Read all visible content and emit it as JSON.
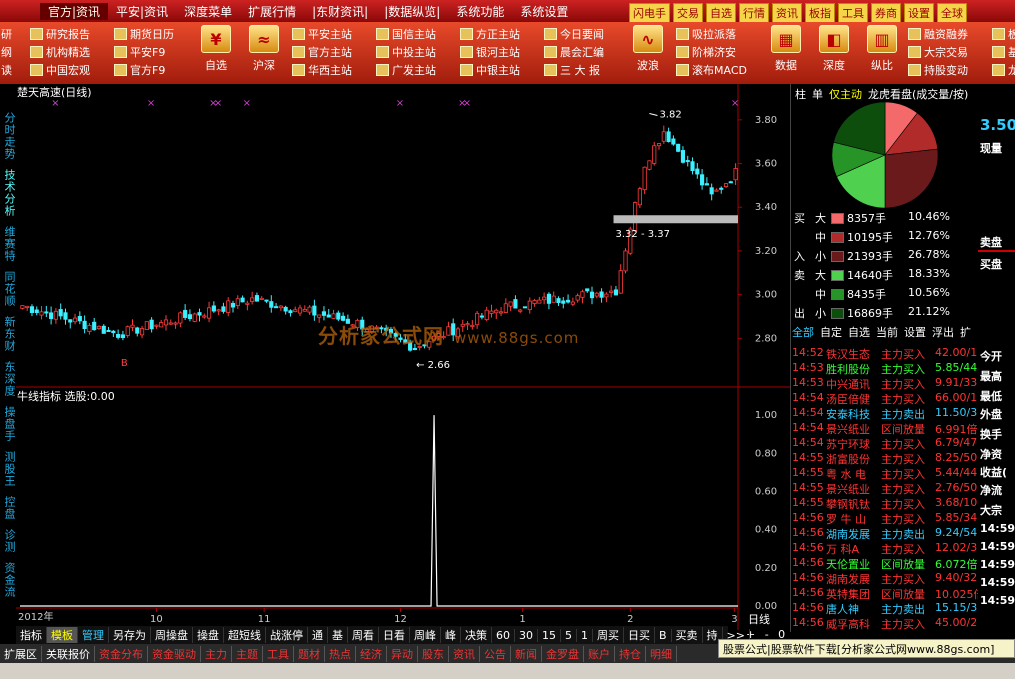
{
  "menu": {
    "items": [
      "官方|资讯",
      "平安|资讯",
      "深度菜单",
      "扩展行情",
      "|东财资讯|",
      "|数据纵览|",
      "系统功能",
      "系统设置"
    ],
    "quick": [
      "闪电手",
      "交易",
      "自选",
      "行情",
      "资讯",
      "板指",
      "工具",
      "券商",
      "设置",
      "全球"
    ]
  },
  "toolbar": {
    "col0": [
      "研",
      "纲",
      "读"
    ],
    "col1": [
      "研究报告",
      "机构精选",
      "中国宏观"
    ],
    "col2": [
      "期货日历",
      "平安F9",
      "官方F9"
    ],
    "big_ziXuan": "自选",
    "big_huShen": "沪深",
    "col3": [
      "平安主站",
      "官方主站",
      "华西主站"
    ],
    "col4": [
      "国信主站",
      "中投主站",
      "广发主站"
    ],
    "col5": [
      "方正主站",
      "银河主站",
      "中银主站"
    ],
    "col6": [
      "今日要闻",
      "晨会汇编",
      "三 大 报"
    ],
    "big_boLang": "波浪",
    "col7": [
      "吸拉派落",
      "阶梯济安",
      "滚布MACD"
    ],
    "big_shuJu": "数据",
    "big_shenDu": "深度",
    "big_zongBi": "纵比",
    "col8": [
      "融资融券",
      "大宗交易",
      "持股变动"
    ],
    "col9": [
      "板",
      "基",
      "龙"
    ]
  },
  "left_tabs": [
    "分时走势",
    "技术分析",
    "维赛特",
    "同花顺",
    "新东财",
    "东深度",
    "操盘手",
    "测股王",
    "控盘",
    "诊测",
    "资金流"
  ],
  "chart": {
    "title": "楚天高速(日线)",
    "indicator_title": "牛线指标 选股:0.00",
    "watermark": "分析家公式网",
    "watermark_url": "www.88gs.com",
    "high_label": "3.82",
    "low_label": "2.66",
    "zone_label": "3.32 - 3.37",
    "b_label": "B",
    "year_label": "2012年",
    "x_ticks": [
      "10",
      "11",
      "12",
      "1",
      "2",
      "3"
    ],
    "y_ticks_price": [
      "3.80",
      "3.60",
      "3.40",
      "3.20",
      "3.00",
      "2.80"
    ],
    "y_ticks_indic": [
      "1.00",
      "0.80",
      "0.60",
      "0.40",
      "0.20",
      "0.00"
    ]
  },
  "chart_data": {
    "type": "candlestick",
    "title": "楚天高速(日线)",
    "ylim": [
      2.6,
      3.9
    ],
    "y_ticks": [
      2.8,
      3.0,
      3.2,
      3.4,
      3.6,
      3.8
    ],
    "x_ticks": [
      "10",
      "11",
      "12",
      "1",
      "2",
      "3"
    ],
    "annotations": [
      {
        "text": "3.82",
        "value": 3.82
      },
      {
        "text": "2.66",
        "value": 2.66
      },
      {
        "text": "3.32 - 3.37",
        "value": 3.345
      }
    ],
    "segments": [
      {
        "from": 0,
        "to": 20,
        "start": 2.95,
        "end": 2.82
      },
      {
        "from": 20,
        "to": 38,
        "start": 2.82,
        "end": 2.92
      },
      {
        "from": 38,
        "to": 48,
        "start": 2.92,
        "end": 2.98
      },
      {
        "from": 48,
        "to": 70,
        "start": 2.98,
        "end": 2.87
      },
      {
        "from": 70,
        "to": 82,
        "start": 2.87,
        "end": 2.76
      },
      {
        "from": 82,
        "to": 100,
        "start": 2.76,
        "end": 2.94
      },
      {
        "from": 100,
        "to": 118,
        "start": 2.94,
        "end": 3.0
      },
      {
        "from": 118,
        "to": 124,
        "start": 3.0,
        "end": 3.02
      },
      {
        "from": 124,
        "to": 130,
        "start": 3.02,
        "end": 3.6
      },
      {
        "from": 130,
        "to": 134,
        "start": 3.6,
        "end": 3.75
      },
      {
        "from": 134,
        "to": 144,
        "start": 3.75,
        "end": 3.45
      },
      {
        "from": 144,
        "to": 150,
        "start": 3.45,
        "end": 3.58
      }
    ],
    "indicator": {
      "ylim": [
        0,
        1.1
      ],
      "spike_index": 86,
      "spike_value": 1.0
    }
  },
  "right": {
    "tabs": [
      "柱",
      "单",
      "仅主动",
      "龙虎看盘(成交量/按)"
    ],
    "flows": [
      {
        "a": "买",
        "b": "大",
        "v": "8357手",
        "p": "10.46%",
        "color": "#f46a6a"
      },
      {
        "a": "",
        "b": "中",
        "v": "10195手",
        "p": "12.76%",
        "color": "#b22b2b"
      },
      {
        "a": "入",
        "b": "小",
        "v": "21393手",
        "p": "26.78%",
        "color": "#6a1a1a"
      },
      {
        "a": "卖",
        "b": "大",
        "v": "14640手",
        "p": "18.33%",
        "color": "#4fd14f"
      },
      {
        "a": "",
        "b": "中",
        "v": "8435手",
        "p": "10.56%",
        "color": "#269426"
      },
      {
        "a": "出",
        "b": "小",
        "v": "16869手",
        "p": "21.12%",
        "color": "#0d4e0d"
      }
    ],
    "list_tabs": [
      "全部",
      "自定",
      "自选",
      "当前",
      "设置",
      "浮出",
      "扩"
    ],
    "deals": [
      {
        "t": "14:52",
        "n": "铁汉生态",
        "k": "主力买入",
        "x": "42.00/1",
        "c": "#f33"
      },
      {
        "t": "14:53",
        "n": "胜利股份",
        "k": "主力买入",
        "x": "5.85/44",
        "c": "#3f3"
      },
      {
        "t": "14:53",
        "n": "中兴通讯",
        "k": "主力买入",
        "x": "9.91/33",
        "c": "#f33"
      },
      {
        "t": "14:54",
        "n": "汤臣倍健",
        "k": "主力买入",
        "x": "66.00/1",
        "c": "#f33"
      },
      {
        "t": "14:54",
        "n": "安泰科技",
        "k": "主力卖出",
        "x": "11.50/3",
        "c": "#3cf"
      },
      {
        "t": "14:54",
        "n": "景兴纸业",
        "k": "区间放量",
        "x": "6.991倍",
        "c": "#f33"
      },
      {
        "t": "14:54",
        "n": "苏宁环球",
        "k": "主力买入",
        "x": "6.79/47",
        "c": "#f33"
      },
      {
        "t": "14:55",
        "n": "浙富股份",
        "k": "主力买入",
        "x": "8.25/50",
        "c": "#f33"
      },
      {
        "t": "14:55",
        "n": "粤 水 电",
        "k": "主力买入",
        "x": "5.44/44",
        "c": "#f33"
      },
      {
        "t": "14:55",
        "n": "景兴纸业",
        "k": "主力买入",
        "x": "2.76/50",
        "c": "#f33"
      },
      {
        "t": "14:55",
        "n": "攀钢钒钛",
        "k": "主力买入",
        "x": "3.68/10",
        "c": "#f33"
      },
      {
        "t": "14:56",
        "n": "罗 牛 山",
        "k": "主力买入",
        "x": "5.85/34",
        "c": "#f33"
      },
      {
        "t": "14:56",
        "n": "湖南发展",
        "k": "主力卖出",
        "x": "9.24/54",
        "c": "#3cf"
      },
      {
        "t": "14:56",
        "n": "万 科A",
        "k": "主力买入",
        "x": "12.02/3",
        "c": "#f33"
      },
      {
        "t": "14:56",
        "n": "天伦置业",
        "k": "区间放量",
        "x": "6.072倍",
        "c": "#3f3"
      },
      {
        "t": "14:56",
        "n": "湖南发展",
        "k": "主力买入",
        "x": "9.40/32",
        "c": "#f33"
      },
      {
        "t": "14:56",
        "n": "英特集团",
        "k": "区间放量",
        "x": "10.025倍",
        "c": "#f33"
      },
      {
        "t": "14:56",
        "n": "唐人神",
        "k": "主力卖出",
        "x": "15.15/3",
        "c": "#3cf"
      },
      {
        "t": "14:56",
        "n": "威孚高科",
        "k": "主力买入",
        "x": "45.00/2",
        "c": "#f33"
      }
    ],
    "day_label": "日线",
    "zoom_label": "+ - 0"
  },
  "farright": {
    "price": "3.50",
    "items": [
      {
        "text": "现量",
        "top": 56
      },
      {
        "text": "卖盘",
        "top": 150
      },
      {
        "text": "买盘",
        "top": 172
      },
      {
        "text": "今开",
        "top": 264
      },
      {
        "text": "最高",
        "top": 284
      },
      {
        "text": "最低",
        "top": 304
      },
      {
        "text": "外盘",
        "top": 322
      },
      {
        "text": "换手",
        "top": 342
      },
      {
        "text": "净资",
        "top": 362
      },
      {
        "text": "收益(",
        "top": 380
      },
      {
        "text": "净流",
        "top": 398
      },
      {
        "text": "大宗",
        "top": 418
      },
      {
        "text": "14:59",
        "top": 438
      },
      {
        "text": "14:59",
        "top": 456
      },
      {
        "text": "14:59",
        "top": 474
      },
      {
        "text": "14:59",
        "top": 492
      },
      {
        "text": "14:59",
        "top": 510
      }
    ]
  },
  "bottom1": [
    "指标",
    "模板",
    "管理",
    "另存为",
    "周操盘",
    "操盘",
    "超短线",
    "战涨停",
    "通",
    "基",
    "周看",
    "日看",
    "周峰",
    "峰",
    "决策",
    "60",
    "30",
    "15",
    "5",
    "1",
    "周买",
    "日买",
    "B",
    "买卖",
    "持",
    ">>"
  ],
  "bottom2": [
    "扩展区",
    "关联报价",
    "资金分布",
    "资金驱动",
    "主力",
    "主题",
    "工具",
    "题材",
    "热点",
    "经济",
    "异动",
    "股东",
    "资讯",
    "公告",
    "新闻",
    "金罗盘",
    "账户",
    "持仓",
    "明细"
  ],
  "ad": "股票公式|股票软件下载[分析家公式网www.88gs.com]"
}
